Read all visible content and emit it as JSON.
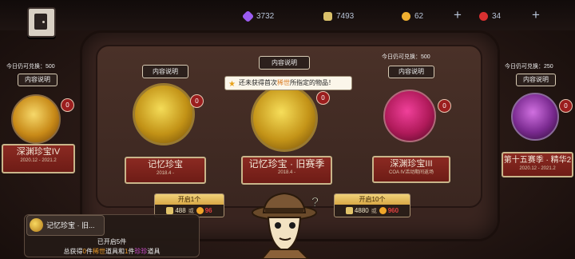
{
  "currency": {
    "purple_gems": "3732",
    "puzzle_pieces": "7493",
    "coins": "62",
    "red_orbs": "34"
  },
  "cards": [
    {
      "id": "abyss4",
      "limit": "今日仍可兑换：500",
      "info": "内容说明",
      "count": "0",
      "title": "深渊珍宝IV",
      "date": "2020.12 - 2021.2"
    },
    {
      "id": "memory",
      "info": "内容说明",
      "count": "0",
      "title": "记忆珍宝",
      "date": "2018.4 -"
    },
    {
      "id": "memory-old",
      "info": "内容说明",
      "count": "0",
      "title": "记忆珍宝 · 旧赛季",
      "date": "2018.4 -"
    },
    {
      "id": "abyss3",
      "limit": "今日仍可兑换：500",
      "info": "内容说明",
      "count": "0",
      "title": "深渊珍宝III",
      "date": "COA IV活动期间返场"
    },
    {
      "id": "season15",
      "limit": "今日仍可兑换：250",
      "info": "内容说明",
      "count": "0",
      "title": "第十五赛季 · 精华2",
      "date": "2020.12 - 2021.2"
    }
  ],
  "tooltip": {
    "pre": "还未获得首次",
    "hl": "稀世",
    "post": "所指定的物品！"
  },
  "open1": {
    "title": "开启1个",
    "puzzle": "488",
    "or": "或",
    "coin": "96"
  },
  "open10": {
    "title": "开启10个",
    "puzzle": "4880",
    "or": "或",
    "coin": "960"
  },
  "bottom_panel": {
    "name": "记忆珍宝 · 旧...",
    "line1": "已开启5件",
    "line2_pre": "总获得",
    "line2_n1": "0",
    "line2_mid1": "件",
    "line2_rare": "稀世",
    "line2_mid2": "道具和",
    "line2_n2": "1",
    "line2_mid3": "件",
    "line2_precious": "珍珍",
    "line2_post": "道具"
  },
  "colors": {
    "banner": "#7b2219",
    "gold": "#d8a846",
    "accent_red": "#e24040"
  },
  "icons": [
    "back-door-icon",
    "purple-gem-icon",
    "puzzle-icon",
    "coin-icon",
    "red-orb-icon",
    "plus-icon",
    "star-icon",
    "detective-character"
  ]
}
